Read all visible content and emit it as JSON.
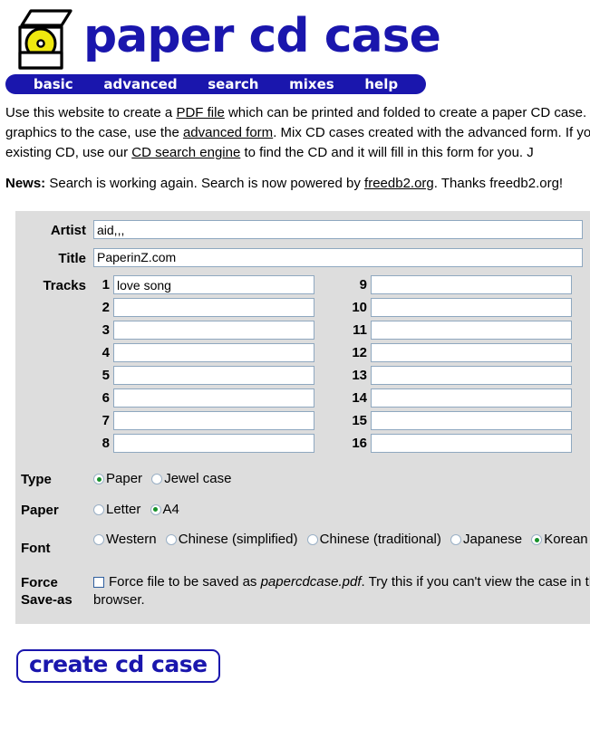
{
  "site": {
    "title": "paper cd case",
    "logo_icon": "cd-case-box-icon"
  },
  "nav": {
    "items": [
      {
        "label": "basic"
      },
      {
        "label": "advanced"
      },
      {
        "label": "search"
      },
      {
        "label": "mixes"
      },
      {
        "label": "help"
      }
    ]
  },
  "intro": {
    "part1": "Use this website to create a ",
    "link1": "PDF file",
    "part2": " which can be printed and folded to create a paper CD case. To add an address, or graphics to the case, use the ",
    "link2": "advanced form",
    "part3": ". Mix CD cases created with the advanced form. If you are making a case for an existing CD, use our ",
    "link3": "CD search engine",
    "part4": " to find the CD and it will fill in this form for you. J"
  },
  "news": {
    "label": "News:",
    "part1": " Search is working again. Search is now powered by ",
    "link": "freedb2.org",
    "part2": ". Thanks freedb2.org!"
  },
  "form": {
    "artist": {
      "label": "Artist",
      "value": "aid,,,",
      "placeholder": ""
    },
    "title": {
      "label": "Title",
      "value": "PaperinZ.com",
      "placeholder": ""
    },
    "tracks": {
      "label": "Tracks",
      "left": [
        {
          "num": "1",
          "value": "love song"
        },
        {
          "num": "2",
          "value": ""
        },
        {
          "num": "3",
          "value": ""
        },
        {
          "num": "4",
          "value": ""
        },
        {
          "num": "5",
          "value": ""
        },
        {
          "num": "6",
          "value": ""
        },
        {
          "num": "7",
          "value": ""
        },
        {
          "num": "8",
          "value": ""
        }
      ],
      "right": [
        {
          "num": "9",
          "value": ""
        },
        {
          "num": "10",
          "value": ""
        },
        {
          "num": "11",
          "value": ""
        },
        {
          "num": "12",
          "value": ""
        },
        {
          "num": "13",
          "value": ""
        },
        {
          "num": "14",
          "value": ""
        },
        {
          "num": "15",
          "value": ""
        },
        {
          "num": "16",
          "value": ""
        }
      ]
    },
    "type": {
      "label": "Type",
      "options": [
        {
          "label": "Paper",
          "selected": true
        },
        {
          "label": "Jewel case",
          "selected": false
        }
      ]
    },
    "paper": {
      "label": "Paper",
      "options": [
        {
          "label": "Letter",
          "selected": false
        },
        {
          "label": "A4",
          "selected": true
        }
      ]
    },
    "font": {
      "label": "Font",
      "options": [
        {
          "label": "Western",
          "selected": false
        },
        {
          "label": "Chinese (simplified)",
          "selected": false
        },
        {
          "label": "Chinese (traditional)",
          "selected": false
        },
        {
          "label": "Japanese",
          "selected": false
        },
        {
          "label": "Korean",
          "selected": true
        }
      ]
    },
    "force_saveas": {
      "label_line1": "Force",
      "label_line2": "Save-as",
      "checked": false,
      "text_part1": "Force file to be saved as ",
      "text_filename": "papercdcase.pdf",
      "text_part2": ". Try this if you can't view the case in the browser."
    },
    "submit": {
      "label": "create cd case"
    }
  },
  "colors": {
    "brand_navy": "#1a16ad",
    "panel_gray": "#dddddd",
    "cd_yellow": "#efe80f",
    "radio_dot_green": "#18922b",
    "input_border": "#8fa8c0"
  }
}
